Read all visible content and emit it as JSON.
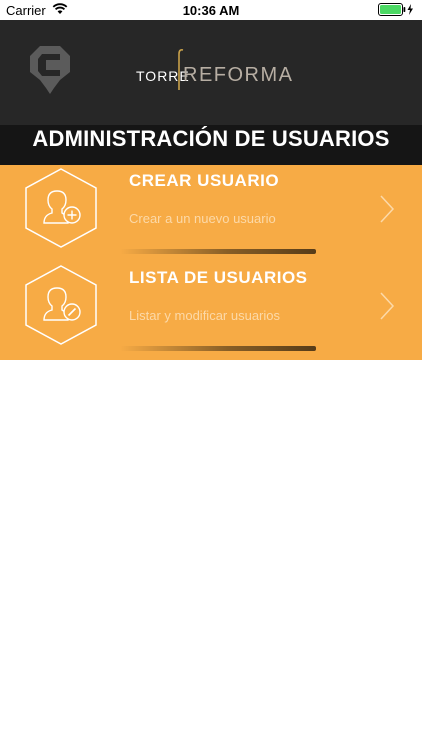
{
  "status_bar": {
    "carrier": "Carrier",
    "time": "10:36 AM",
    "wifi_icon": "wifi-icon",
    "battery_icon": "battery-charging-icon"
  },
  "header": {
    "app_logo_icon": "location-pin-logo-icon",
    "brand_word_1": "TORRE",
    "brand_word_2": "REFORMA",
    "background_color": "#272727",
    "brand_accent_color": "#c8a14a"
  },
  "title_bar": {
    "title": "ADMINISTRACIÓN DE USUARIOS"
  },
  "menu": {
    "background_color": "#f7ab45",
    "items": [
      {
        "title": "CREAR USUARIO",
        "subtitle": "Crear a un nuevo usuario",
        "icon": "user-add-icon",
        "chevron_icon": "chevron-right-icon"
      },
      {
        "title": "LISTA DE USUARIOS",
        "subtitle": "Listar y modificar usuarios",
        "icon": "user-edit-icon",
        "chevron_icon": "chevron-right-icon"
      }
    ]
  }
}
